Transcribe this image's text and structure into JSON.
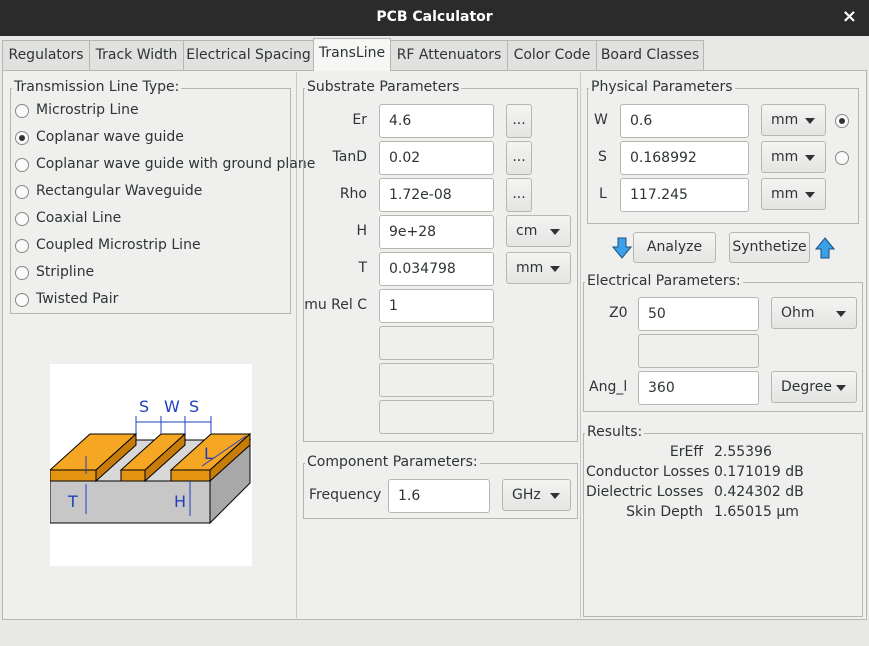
{
  "window": {
    "title": "PCB Calculator",
    "close_symbol": "×"
  },
  "tabs": [
    "Regulators",
    "Track Width",
    "Electrical Spacing",
    "TransLine",
    "RF Attenuators",
    "Color Code",
    "Board Classes"
  ],
  "active_tab": "TransLine",
  "line_type": {
    "title": "Transmission Line Type:",
    "options": [
      "Microstrip Line",
      "Coplanar wave guide",
      "Coplanar wave guide with ground plane",
      "Rectangular Waveguide",
      "Coaxial Line",
      "Coupled Microstrip Line",
      "Stripline",
      "Twisted Pair"
    ],
    "selected": "Coplanar wave guide"
  },
  "diagram": {
    "label_s1": "S",
    "label_w": "W",
    "label_s2": "S",
    "label_l": "L",
    "label_t": "T",
    "label_h": "H",
    "colors": {
      "copper": "#f5a623",
      "substrate": "#c7c7c7",
      "dim": "#1f3fbf"
    }
  },
  "substrate": {
    "title": "Substrate Parameters",
    "params": [
      {
        "label": "Er",
        "value": "4.6",
        "btn": "..."
      },
      {
        "label": "TanD",
        "value": "0.02",
        "btn": "..."
      },
      {
        "label": "Rho",
        "value": "1.72e-08",
        "btn": "..."
      },
      {
        "label": "H",
        "value": "9e+28",
        "unit": "cm"
      },
      {
        "label": "T",
        "value": "0.034798",
        "unit": "mm"
      },
      {
        "label": "mu Rel C",
        "value": "1"
      }
    ]
  },
  "component": {
    "title": "Component Parameters:",
    "label": "Frequency",
    "value": "1.6",
    "unit": "GHz"
  },
  "physical": {
    "title": "Physical Parameters",
    "params": [
      {
        "label": "W",
        "value": "0.6",
        "unit": "mm",
        "radio": true
      },
      {
        "label": "S",
        "value": "0.168992",
        "unit": "mm",
        "radio": false
      },
      {
        "label": "L",
        "value": "117.245",
        "unit": "mm"
      }
    ]
  },
  "actions": {
    "analyze": "Analyze",
    "synthetize": "Synthetize"
  },
  "electrical": {
    "title": "Electrical Parameters:",
    "z0": {
      "label": "Z0",
      "value": "50",
      "unit": "Ohm"
    },
    "angl": {
      "label": "Ang_l",
      "value": "360",
      "unit": "Degree"
    }
  },
  "results": {
    "title": "Results:",
    "rows": [
      {
        "label": "ErEff",
        "value": "2.55396"
      },
      {
        "label": "Conductor Losses",
        "value": "0.171019 dB"
      },
      {
        "label": "Dielectric Losses",
        "value": "0.424302 dB"
      },
      {
        "label": "Skin Depth",
        "value": "1.65015 µm"
      }
    ]
  }
}
